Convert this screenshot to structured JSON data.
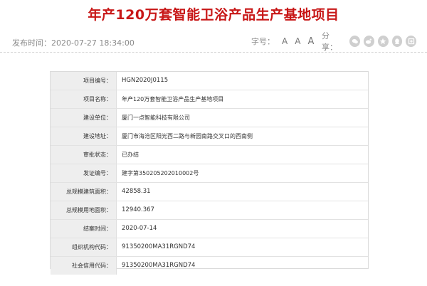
{
  "title": "年产120万套智能卫浴产品生产基地项目",
  "meta": {
    "publish": "发布时间：2020-07-27 18:34:00",
    "fontsize_label": "字号：",
    "font_small": "A",
    "font_medium": "A",
    "font_large": "A",
    "share_label": "分享："
  },
  "share_icons": [
    "wechat-icon",
    "weibo-icon",
    "qq-space-icon",
    "qq-icon",
    "share-more-icon"
  ],
  "rows": [
    {
      "label": "项目编号：",
      "value": "HGN2020J0115"
    },
    {
      "label": "项目名称：",
      "value": "年产120万套智能卫浴产品生产基地项目"
    },
    {
      "label": "建设单位：",
      "value": "厦门一点智能科技有限公司"
    },
    {
      "label": "建设地址：",
      "value": "厦门市海沧区阳光西二路与新园南路交叉口的西南侧"
    },
    {
      "label": "审批状态：",
      "value": "已办结"
    },
    {
      "label": "发证编号：",
      "value": "建字第350205202010002号"
    },
    {
      "label": "总规模建筑面积：",
      "value": "42858.31"
    },
    {
      "label": "总规模用地面积：",
      "value": "12940.367"
    },
    {
      "label": "结案时间：",
      "value": "2020-07-14"
    },
    {
      "label": "组织机构代码：",
      "value": "91350200MA31RGND74"
    },
    {
      "label": "社会信用代码：",
      "value": "91350200MA31RGND74"
    }
  ],
  "colors": {
    "title": "#c81717",
    "label_bg": "#eeeeee",
    "icon_bg": "#cfcfcf"
  }
}
